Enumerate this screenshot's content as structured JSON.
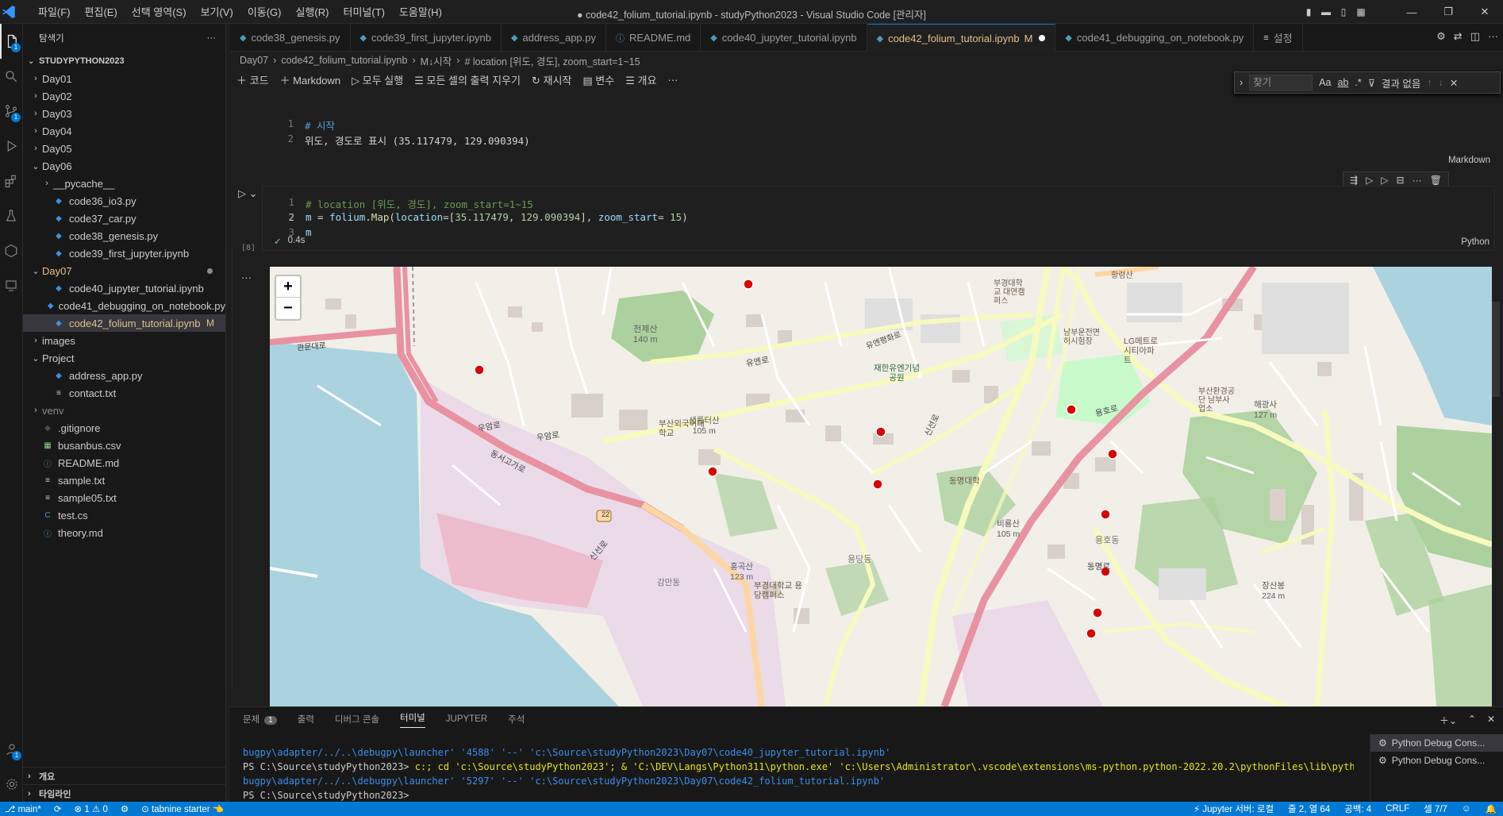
{
  "window": {
    "title": "● code42_folium_tutorial.ipynb - studyPython2023 - Visual Studio Code [관리자]",
    "menus": [
      "파일(F)",
      "편집(E)",
      "선택 영역(S)",
      "보기(V)",
      "이동(G)",
      "실행(R)",
      "터미널(T)",
      "도움말(H)"
    ]
  },
  "activity": {
    "explorer_badge": "1",
    "scm_badge": "1",
    "accounts_badge": "1"
  },
  "sidebar": {
    "title": "탐색기",
    "root": "STUDYPYTHON2023",
    "items": [
      {
        "label": "Day01",
        "type": "folder",
        "depth": 1
      },
      {
        "label": "Day02",
        "type": "folder",
        "depth": 1
      },
      {
        "label": "Day03",
        "type": "folder",
        "depth": 1
      },
      {
        "label": "Day04",
        "type": "folder",
        "depth": 1
      },
      {
        "label": "Day05",
        "type": "folder",
        "depth": 1
      },
      {
        "label": "Day06",
        "type": "folder-open",
        "depth": 1
      },
      {
        "label": "__pycache__",
        "type": "folder",
        "depth": 2
      },
      {
        "label": "code36_io3.py",
        "type": "py",
        "depth": 2
      },
      {
        "label": "code37_car.py",
        "type": "py",
        "depth": 2
      },
      {
        "label": "code38_genesis.py",
        "type": "py",
        "depth": 2
      },
      {
        "label": "code39_first_jupyter.ipynb",
        "type": "ipynb",
        "depth": 2
      },
      {
        "label": "Day07",
        "type": "folder-open",
        "depth": 1
      },
      {
        "label": "code40_jupyter_tutorial.ipynb",
        "type": "ipynb",
        "depth": 2
      },
      {
        "label": "code41_debugging_on_notebook.py",
        "type": "py",
        "depth": 2
      },
      {
        "label": "code42_folium_tutorial.ipynb",
        "type": "ipynb",
        "depth": 2
      },
      {
        "label": "images",
        "type": "folder",
        "depth": 1
      },
      {
        "label": "Project",
        "type": "folder-open",
        "depth": 1
      },
      {
        "label": "address_app.py",
        "type": "py",
        "depth": 2
      },
      {
        "label": "contact.txt",
        "type": "txt",
        "depth": 2
      },
      {
        "label": "venv",
        "type": "folder",
        "depth": 1
      },
      {
        "label": ".gitignore",
        "type": "git",
        "depth": 1
      },
      {
        "label": "busanbus.csv",
        "type": "csv",
        "depth": 1
      },
      {
        "label": "README.md",
        "type": "md",
        "depth": 1
      },
      {
        "label": "sample.txt",
        "type": "txt",
        "depth": 1
      },
      {
        "label": "sample05.txt",
        "type": "txt",
        "depth": 1
      },
      {
        "label": "test.cs",
        "type": "cs",
        "depth": 1
      },
      {
        "label": "theory.md",
        "type": "md",
        "depth": 1
      }
    ],
    "modified_mark": "M",
    "outline": "개요",
    "timeline": "타임라인"
  },
  "tabs": [
    {
      "label": "code38_genesis.py",
      "icon": "py"
    },
    {
      "label": "code39_first_jupyter.ipynb",
      "icon": "ipynb"
    },
    {
      "label": "address_app.py",
      "icon": "py"
    },
    {
      "label": "README.md",
      "icon": "info"
    },
    {
      "label": "code40_jupyter_tutorial.ipynb",
      "icon": "ipynb"
    },
    {
      "label": "code42_folium_tutorial.ipynb",
      "icon": "ipynb",
      "active": true,
      "mod": "M"
    },
    {
      "label": "code41_debugging_on_notebook.py",
      "icon": "py"
    },
    {
      "label": "설정",
      "icon": "settings"
    }
  ],
  "breadcrumb": [
    "Day07",
    "code42_folium_tutorial.ipynb",
    "M↓시작",
    "# location [위도, 경도], zoom_start=1~15"
  ],
  "toolbar": {
    "code": "코드",
    "markdown": "Markdown",
    "run_all": "모두 실행",
    "clear_outputs": "모든 셀의 출력 지우기",
    "restart": "재시작",
    "variables": "변수",
    "outline": "개요"
  },
  "find": {
    "placeholder": "찾기",
    "opt1": "Aa",
    "opt2": "ab",
    "opt3": ".*",
    "result": "결과 없음"
  },
  "cells": {
    "md": {
      "line1": "# 시작",
      "line2": "위도, 경도로 표시 (35.117479, 129.090394)",
      "lang": "Markdown"
    },
    "code": {
      "line1": "# location [위도, 경도], zoom_start=1~15",
      "line2_a": "m",
      "line2_b": " = ",
      "line2_c": "folium",
      "line2_d": ".",
      "line2_e": "Map",
      "line2_f": "(",
      "line2_g": "location",
      "line2_h": "=[",
      "line2_i": "35.117479",
      "line2_j": ", ",
      "line2_k": "129.090394",
      "line2_l": "], ",
      "line2_m": "zoom_start",
      "line2_n": "= ",
      "line2_o": "15",
      "line2_p": ")",
      "line3": "m",
      "exec_count": "[8]",
      "duration": "0.4s",
      "lang": "Python"
    }
  },
  "map": {
    "zoom_in": "+",
    "zoom_out": "−",
    "labels": {
      "l1": "천제산",
      "l1b": "140 m",
      "l2": "부산외국어대학교",
      "l3": "생률터산",
      "l3b": "105 m",
      "l4": "우암로",
      "l5": "우암로",
      "l6": "동서고가로",
      "l7": "신선로",
      "l8": "신선로",
      "l9": "용호로",
      "l10": "용당동",
      "l11": "부경대학교 용당캠퍼스",
      "l12": "부경대학교 대연캠퍼스",
      "l13": "동명대학",
      "l14": "LG메트로시티아파트",
      "l15": "황령산",
      "l16": "비룡산",
      "l16b": "105 m",
      "l17": "홍곡산",
      "l17b": "123 m",
      "l18": "장산봉",
      "l18b": "224 m",
      "l19": "유엔평화로",
      "l20": "유엔로",
      "l21": "재한유엔기념공원",
      "l22": "감만동",
      "l23": "22",
      "l24": "관문대로",
      "l25": "동명로",
      "l26": "용호동",
      "l27": "부산환경공단 남부사업소",
      "l28": "남부운전면허시험장",
      "l29": "해광사",
      "l29b": "127 m"
    }
  },
  "panel": {
    "tabs": [
      "문제",
      "출력",
      "디버그 콘솔",
      "터미널",
      "JUPYTER",
      "주석"
    ],
    "problems_badge": "1",
    "terminal": [
      "bugpy\\adapter/../..\\debugpy\\launcher' '4588' '--' 'c:\\Source\\studyPython2023\\Day07\\code40_jupyter_tutorial.ipynb'",
      "PS C:\\Source\\studyPython2023>",
      " c:; cd 'c:\\Source\\studyPython2023'; & 'C:\\DEV\\Langs\\Python311\\python.exe' 'c:\\Users\\Administrator\\.vscode\\extensions\\ms-python.python-2022.20.2\\pythonFiles\\lib\\python\\de",
      "bugpy\\adapter/../..\\debugpy\\launcher' '5297' '--' 'c:\\Source\\studyPython2023\\Day07\\code42_folium_tutorial.ipynb'",
      "PS C:\\Source\\studyPython2023>"
    ],
    "sessions": [
      "Python Debug Cons...",
      "Python Debug Cons..."
    ]
  },
  "status": {
    "branch": "main*",
    "errors": "1",
    "warnings": "0",
    "tabnine": "tabnine starter 👈",
    "jupyter": "Jupyter 서버: 로컬",
    "position": "줄 2, 열 64",
    "spaces": "공백: 4",
    "eol": "CRLF",
    "cells": "셀 7/7"
  },
  "colors": {
    "accent": "#0078d4",
    "background": "#1e1e1e",
    "sidebar": "#181818",
    "status": "#0078d4"
  }
}
